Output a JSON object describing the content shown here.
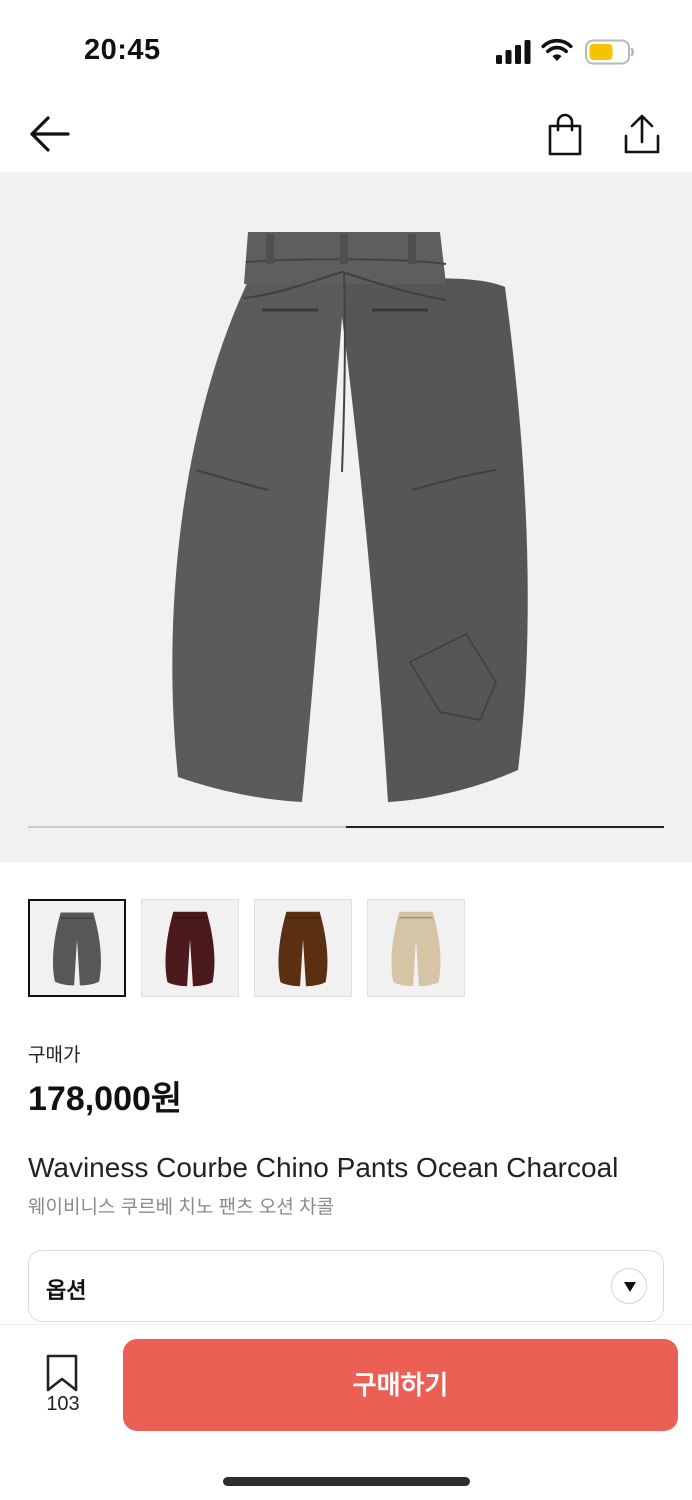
{
  "status_bar": {
    "time": "20:45",
    "icons": [
      "signal-icon",
      "wifi-icon",
      "battery-icon"
    ],
    "battery_color": "#f5c400"
  },
  "header": {
    "icons": [
      "back-arrow-icon",
      "shopping-bag-icon",
      "share-icon"
    ]
  },
  "gallery": {
    "background": "#f1f1f1",
    "current_page": 2,
    "total_pages": 2,
    "main_color": "#575757"
  },
  "thumbnails": [
    {
      "name": "thumb-charcoal",
      "color": "#575757",
      "selected": true
    },
    {
      "name": "thumb-burgundy",
      "color": "#4a1a1c",
      "selected": false
    },
    {
      "name": "thumb-brown",
      "color": "#5a2f12",
      "selected": false
    },
    {
      "name": "thumb-beige",
      "color": "#d6c4a6",
      "selected": false
    }
  ],
  "product": {
    "price_label": "구매가",
    "price": "178,000원",
    "name_en": "Waviness Courbe Chino Pants Ocean Charcoal",
    "name_ko": "웨이비니스 쿠르베 치노 팬츠 오션 차콜"
  },
  "option": {
    "label": "옵션"
  },
  "bottom_bar": {
    "wish_count": "103",
    "buy_label": "구매하기",
    "accent": "#ec5f55"
  }
}
